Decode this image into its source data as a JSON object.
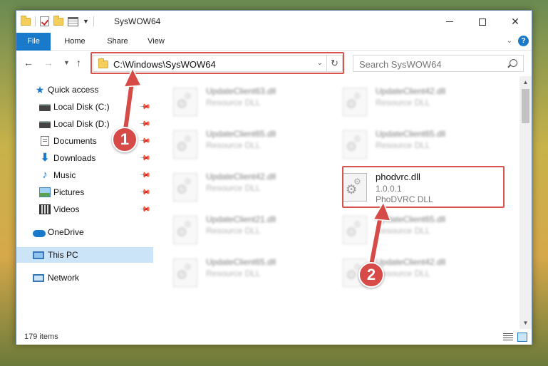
{
  "window": {
    "title": "SysWOW64",
    "controls": {
      "minimize": "",
      "maximize": "",
      "close": "✕"
    }
  },
  "ribbon": {
    "tabs": [
      "File",
      "Home",
      "Share",
      "View"
    ],
    "help": "?"
  },
  "address": {
    "path": "C:\\Windows\\SysWOW64",
    "refresh_glyph": "↻"
  },
  "search": {
    "placeholder": "Search SysWOW64"
  },
  "nav_pane": {
    "items": [
      {
        "label": "Quick access",
        "icon": "star-icon",
        "pinned": false
      },
      {
        "label": "Local Disk (C:)",
        "icon": "disk-icon",
        "pinned": true
      },
      {
        "label": "Local Disk (D:)",
        "icon": "disk-icon",
        "pinned": true
      },
      {
        "label": "Documents",
        "icon": "documents-icon",
        "pinned": true
      },
      {
        "label": "Downloads",
        "icon": "downloads-icon",
        "pinned": true
      },
      {
        "label": "Music",
        "icon": "music-icon",
        "pinned": true
      },
      {
        "label": "Pictures",
        "icon": "pictures-icon",
        "pinned": true
      },
      {
        "label": "Videos",
        "icon": "videos-icon",
        "pinned": true
      },
      {
        "label": "OneDrive",
        "icon": "onedrive-icon",
        "pinned": false
      },
      {
        "label": "This PC",
        "icon": "this-pc-icon",
        "pinned": false,
        "selected": true
      },
      {
        "label": "Network",
        "icon": "network-icon",
        "pinned": false
      }
    ]
  },
  "files": [
    {
      "name": "UpdateClient63.dll",
      "desc": "Resource DLL",
      "blurred": true
    },
    {
      "name": "UpdateClient42.dll",
      "desc": "Resource DLL",
      "blurred": true
    },
    {
      "name": "UpdateClient65.dll",
      "desc": "Resource DLL",
      "blurred": true
    },
    {
      "name": "UpdateClient65.dll",
      "desc": "Resource DLL",
      "blurred": true
    },
    {
      "name": "UpdateClient42.dll",
      "desc": "Resource DLL",
      "blurred": true
    },
    {
      "name": "phodvrc.dll",
      "version": "1.0.0.1",
      "desc": "PhoDVRC DLL",
      "blurred": false
    },
    {
      "name": "UpdateClient21.dll",
      "desc": "Resource DLL",
      "blurred": true
    },
    {
      "name": "UpdateClient65.dll",
      "desc": "Resource DLL",
      "blurred": true
    },
    {
      "name": "UpdateClient65.dll",
      "desc": "Resource DLL",
      "blurred": true
    },
    {
      "name": "UpdateClient42.dll",
      "desc": "Resource DLL",
      "blurred": true
    }
  ],
  "status": {
    "item_count": "179 items"
  },
  "annotations": {
    "callout_1": "1",
    "callout_2": "2"
  },
  "colors": {
    "accent": "#1979ca",
    "highlight": "#d9534f",
    "callout": "#d64b47",
    "selection": "#cce4f7"
  }
}
